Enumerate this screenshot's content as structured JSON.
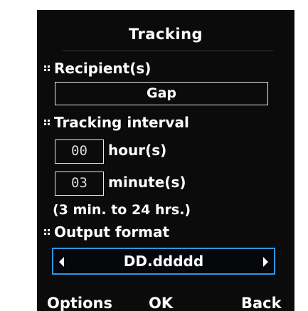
{
  "screen": {
    "title": "Tracking"
  },
  "recipients": {
    "label": "Recipient(s)",
    "value": "Gap"
  },
  "tracking_interval": {
    "label": "Tracking interval",
    "hours_value": "00",
    "hours_unit": "hour(s)",
    "minutes_value": "03",
    "minutes_unit": "minute(s)",
    "range_note": "(3 min. to 24 hrs.)"
  },
  "output_format": {
    "label": "Output format",
    "value": "DD.ddddd"
  },
  "softkeys": {
    "left": "Options",
    "center": "OK",
    "right": "Back"
  },
  "colors": {
    "background": "#0b0b0c",
    "text": "#ffffff",
    "selection_border": "#2d97e6"
  },
  "icons": {
    "section_bullet": "square-bullet-icon",
    "left_arrow": "triangle-left-icon",
    "right_arrow": "triangle-right-icon"
  }
}
